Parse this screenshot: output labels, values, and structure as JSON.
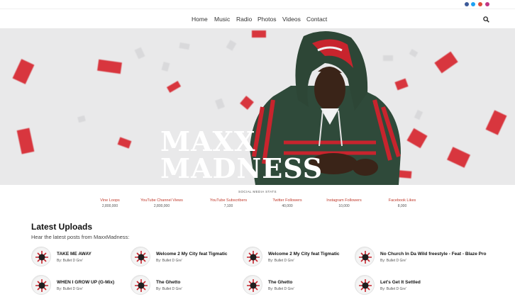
{
  "social_icons": [
    "facebook-icon",
    "twitter-icon",
    "google-plus-icon",
    "instagram-icon"
  ],
  "nav": {
    "items": [
      "Home",
      "Music",
      "Radio",
      "Photos",
      "Videos",
      "Contact"
    ],
    "search_icon": "search-icon"
  },
  "hero": {
    "title_line1": "MAXX",
    "title_line2": "MADNESS"
  },
  "stats": {
    "heading": "SOCIAL MEDIA STATS",
    "items": [
      {
        "label": "Vine Loops",
        "value": "2,800,000"
      },
      {
        "label": "YouTube Channel Views",
        "value": "2,800,000"
      },
      {
        "label": "YouTube Subscribers",
        "value": "7,100"
      },
      {
        "label": "Twitter Followers",
        "value": "40,000"
      },
      {
        "label": "Instagram Followers",
        "value": "10,000"
      },
      {
        "label": "Facebook Likes",
        "value": "8,000"
      }
    ]
  },
  "uploads": {
    "title": "Latest Uploads",
    "subtitle": "Hear the latest posts from MaxxMadness:",
    "tracks": [
      {
        "title": "TAKE ME AWAY",
        "artist": "By: Bullet D Gre'"
      },
      {
        "title": "Welcome 2 My City feat Tigmatic",
        "artist": "By: Bullet D Gre'"
      },
      {
        "title": "Welcome 2 My City feat Tigmatic",
        "artist": "By: Bullet D Gre'"
      },
      {
        "title": "No Church In Da Wild freestyle - Feat - Blaze Pro",
        "artist": "By: Bullet D Gre'"
      },
      {
        "title": "WHEN I GROW UP (G-Mix)",
        "artist": "By: Bullet D Gre'"
      },
      {
        "title": "The Ghetto",
        "artist": "By: Bullet D Gre'"
      },
      {
        "title": "The Ghetto",
        "artist": "By: Bullet D Gre'"
      },
      {
        "title": "Let's Get It Settled",
        "artist": "By: Bullet D Gre'"
      }
    ]
  },
  "colors": {
    "accent": "#c0392b",
    "confetti": "#d8363e",
    "hero_bg": "#e9e9ea"
  }
}
